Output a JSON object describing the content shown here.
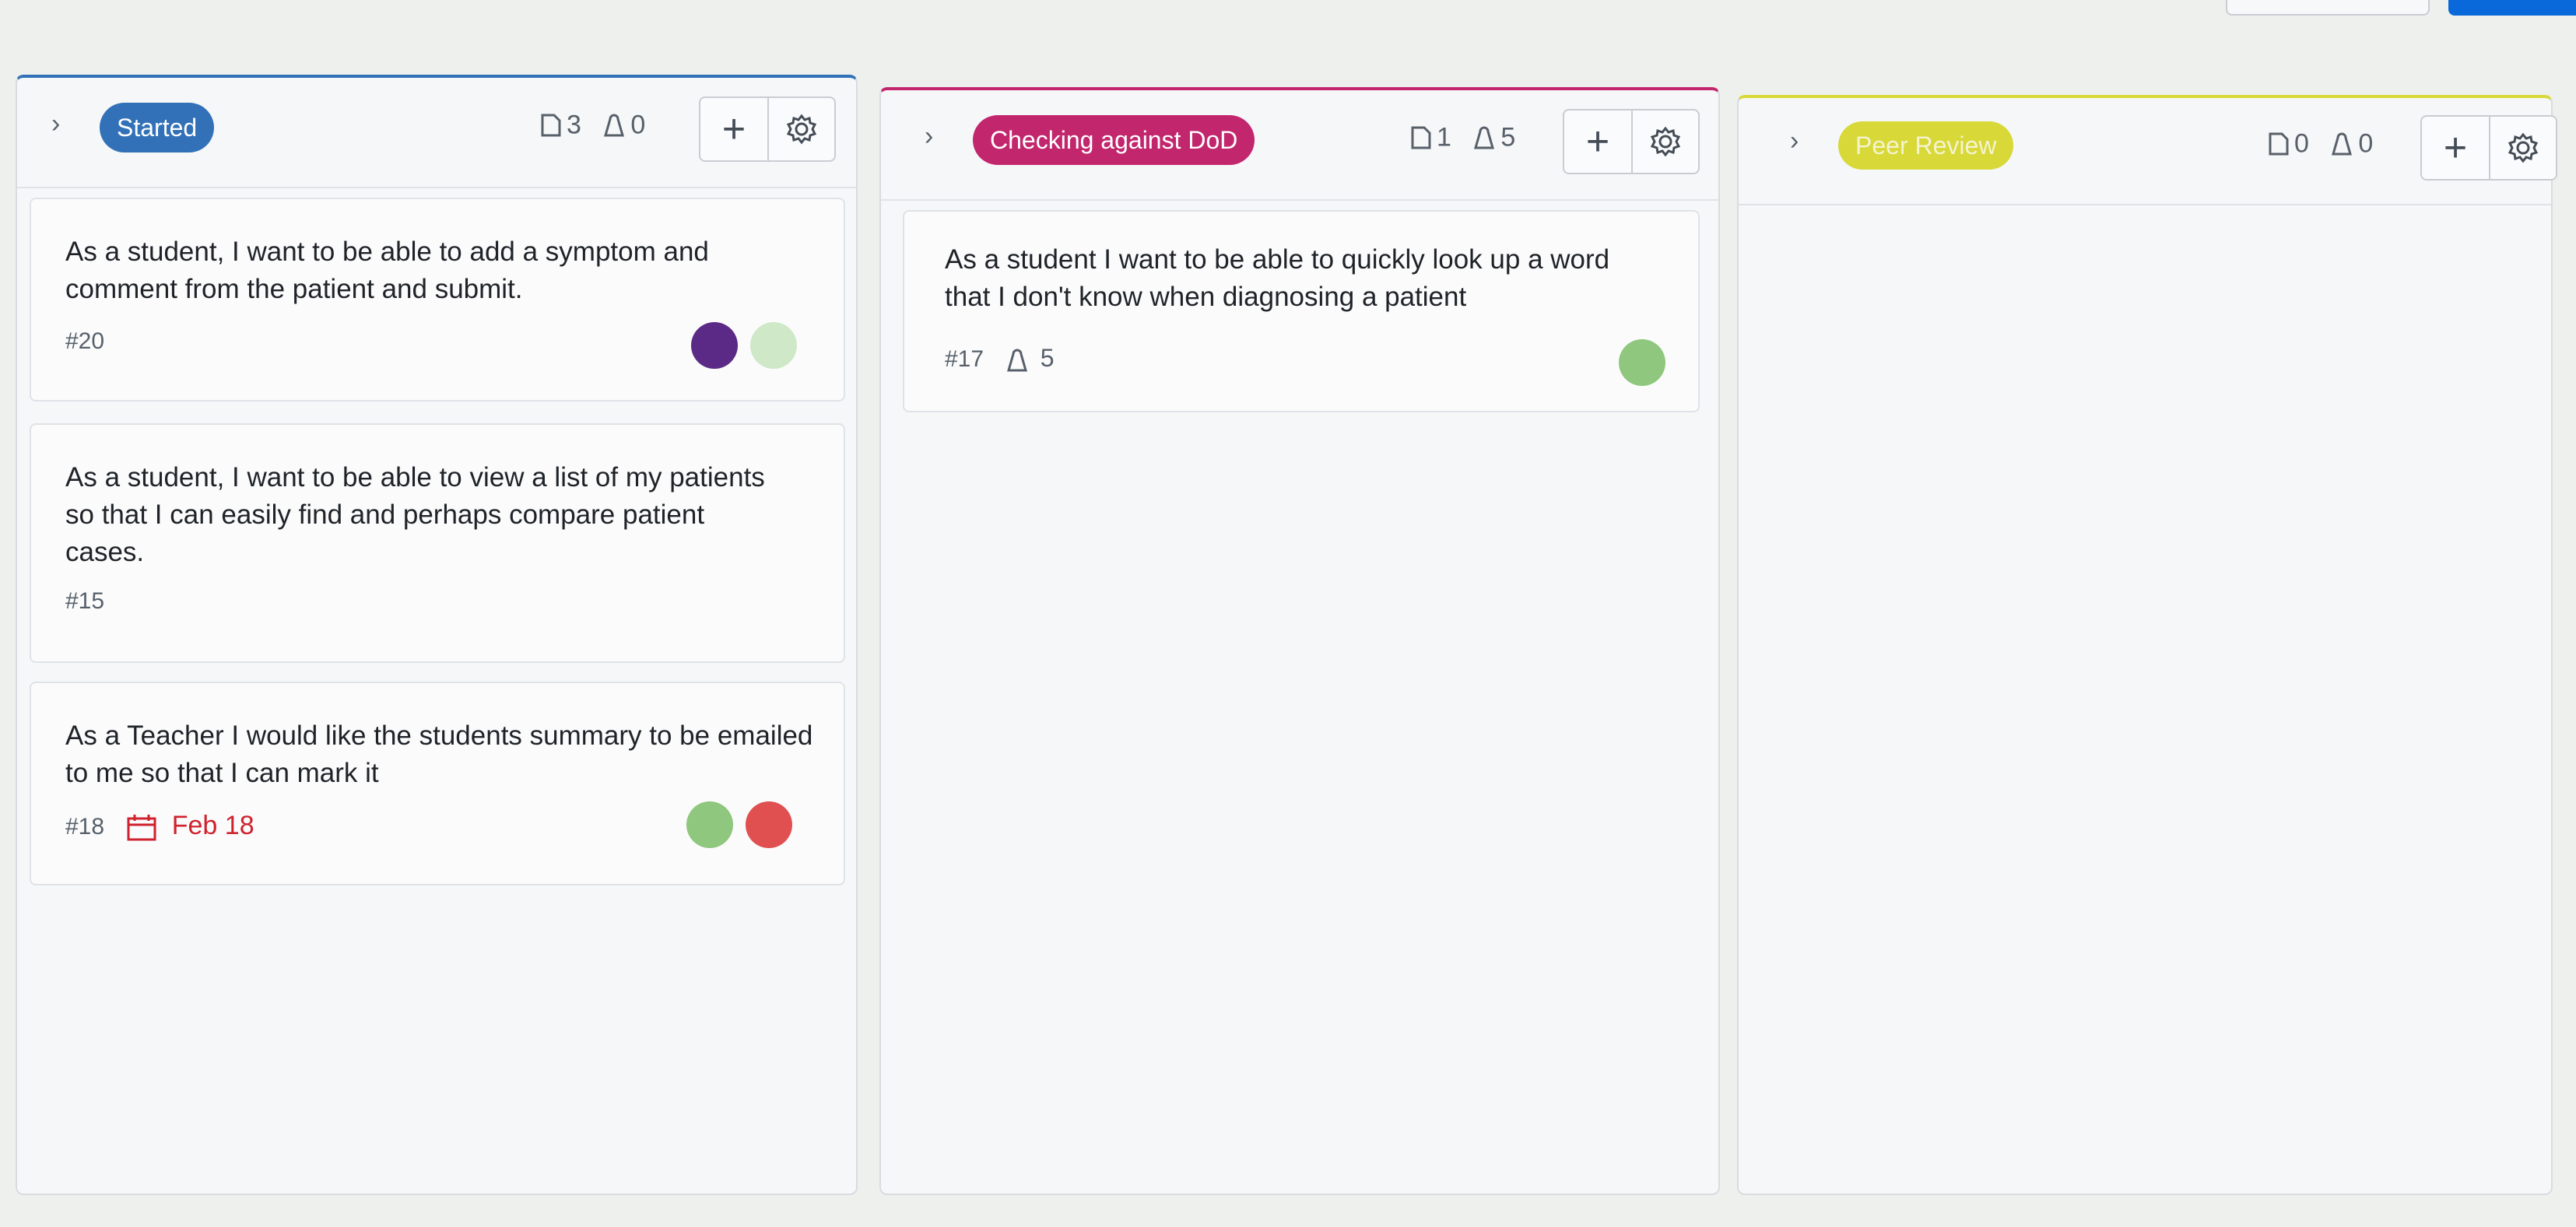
{
  "board": {
    "columns": [
      {
        "name": "Started",
        "color": "#3271b8",
        "item_count": "3",
        "estimate": "0",
        "cards": [
          {
            "title": "As a student, I want to be able to add a symptom and comment from the patient and submit.",
            "number": "#20",
            "avatars": [
              "#5b2a86",
              "#c7e6c0"
            ]
          },
          {
            "title": "As a student, I want to be able to view a list of my patients so that I can easily find and perhaps compare patient cases.",
            "number": "#15"
          },
          {
            "title": "As a Teacher I would like the students summary to be emailed to me so that I can mark it",
            "number": "#18",
            "date": "Feb 18",
            "avatars": [
              "#8fc77e",
              "#e05050"
            ]
          }
        ]
      },
      {
        "name": "Checking against DoD",
        "color": "#c2266d",
        "item_count": "1",
        "estimate": "5",
        "cards": [
          {
            "title": "As a student I want to be able to quickly look up a word that I don't know when diagnosing a patient",
            "number": "#17",
            "estimate": "5",
            "avatars": [
              "#8fc77e"
            ]
          }
        ]
      },
      {
        "name": "Peer Review",
        "color": "#d8d838",
        "item_count": "0",
        "estimate": "0",
        "cards": []
      }
    ]
  },
  "icons": {
    "items": "issue-count-icon",
    "estimate": "estimate-icon",
    "add": "plus-icon",
    "settings": "gear-icon",
    "collapse": "chevron-right-icon",
    "date": "calendar-icon"
  }
}
